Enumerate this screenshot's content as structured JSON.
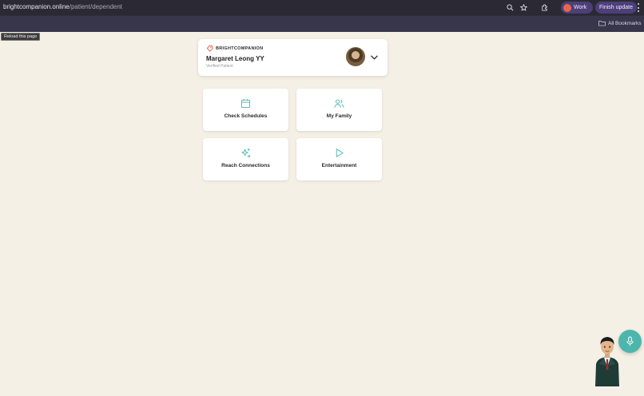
{
  "browser": {
    "url_host": "brightcompanion.online",
    "url_path": "/patient/dependent",
    "profile_label": "Work",
    "update_label": "Finish update",
    "bookmarks_label": "All Bookmarks",
    "tooltip": "Reload this page"
  },
  "header": {
    "brand": "BRIGHTCOMPANION",
    "patient_name": "Margaret Leong YY",
    "patient_status": "Verified Patient"
  },
  "tiles": [
    {
      "label": "Check Schedules",
      "icon": "calendar-icon"
    },
    {
      "label": "My Family",
      "icon": "users-icon"
    },
    {
      "label": "Reach Connections",
      "icon": "sparkles-icon"
    },
    {
      "label": "Entertainment",
      "icon": "play-icon"
    }
  ],
  "colors": {
    "accent": "#4db6ac",
    "brand": "#e6674a",
    "background": "#f5f0e6"
  }
}
